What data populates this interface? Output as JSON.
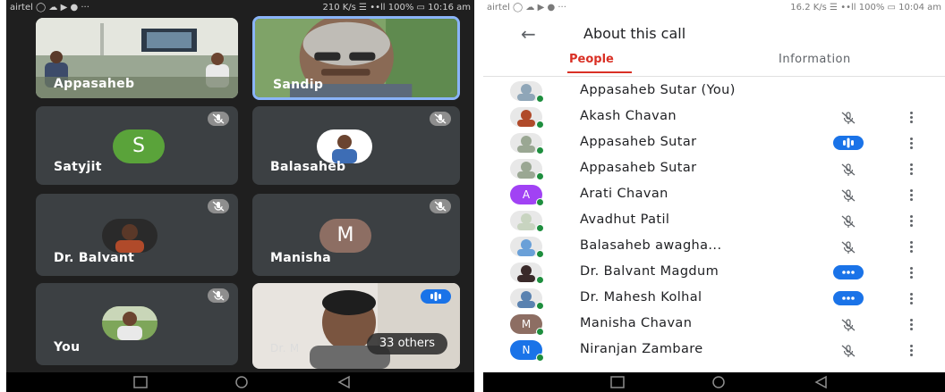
{
  "left_phone": {
    "status": {
      "left": "airtel ◯ ☁ ▶ ● ···",
      "right": "210 K/s ☰ ••ll 100% ▭ 10:16 am"
    },
    "tiles": [
      {
        "name": "Appasaheb"
      },
      {
        "name": "Sandip"
      },
      {
        "name": "Satyjit",
        "avatar_letter": "S",
        "avatar_color": "#5aa33a"
      },
      {
        "name": "Balasaheb"
      },
      {
        "name": "Dr. Balvant"
      },
      {
        "name": "Manisha",
        "avatar_letter": "M",
        "avatar_color": "#8d6e63"
      },
      {
        "name": "You"
      },
      {
        "name": "Dr. M",
        "others_label": "33 others"
      }
    ]
  },
  "right_phone": {
    "status": {
      "left": "airtel ◯ ☁ ▶ ● ···",
      "right": "16.2 K/s ☰ ••ll 100% ▭ 10:04 am"
    },
    "back_icon": "arrow-left-icon",
    "title": "About this call",
    "tabs": [
      {
        "label": "People"
      },
      {
        "label": "Information"
      }
    ],
    "accent_color": "#d93025",
    "speaking_color": "#1a73e8",
    "people": [
      {
        "name": "Appasaheb Sutar (You)",
        "avatar": "photo",
        "status": "none"
      },
      {
        "name": "Akash Chavan",
        "avatar": "photo",
        "status": "muted"
      },
      {
        "name": "Appasaheb Sutar",
        "avatar": "photo",
        "status": "speaking"
      },
      {
        "name": "Appasaheb Sutar",
        "avatar": "photo",
        "status": "muted"
      },
      {
        "name": "Arati Chavan",
        "avatar_letter": "A",
        "avatar_color": "#a142f4",
        "status": "muted"
      },
      {
        "name": "Avadhut Patil",
        "avatar": "photo",
        "status": "muted"
      },
      {
        "name": "Balasaheb awagha...",
        "avatar": "photo",
        "status": "muted"
      },
      {
        "name": "Dr. Balvant Magdum",
        "avatar": "photo",
        "status": "dots"
      },
      {
        "name": "Dr. Mahesh Kolhal",
        "avatar": "photo",
        "status": "dots"
      },
      {
        "name": "Manisha Chavan",
        "avatar_letter": "M",
        "avatar_color": "#8d6e63",
        "status": "muted"
      },
      {
        "name": "Niranjan Zambare",
        "avatar_letter": "N",
        "avatar_color": "#1a73e8",
        "status": "muted"
      }
    ]
  }
}
